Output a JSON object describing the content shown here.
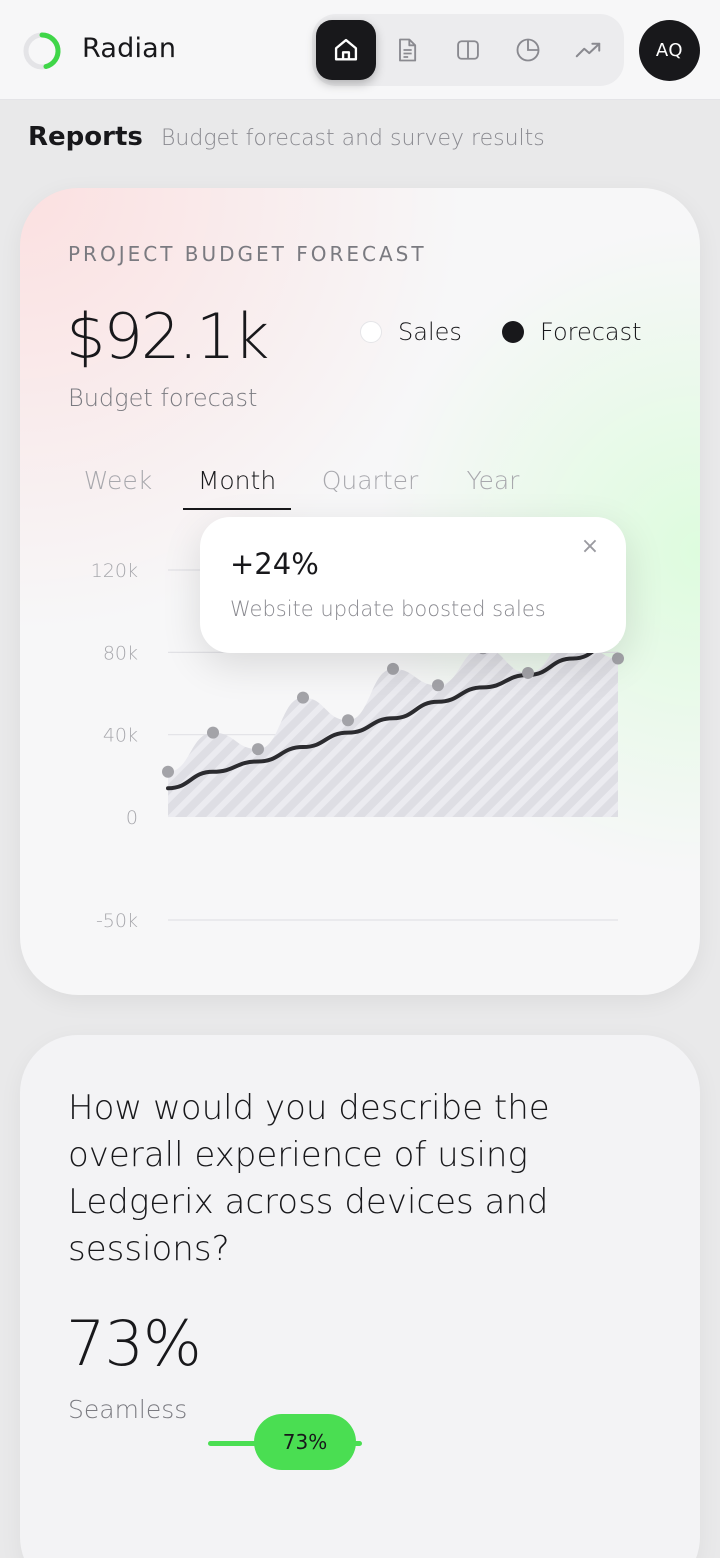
{
  "app": {
    "name": "Radian"
  },
  "nav": {
    "items": [
      {
        "icon": "home-icon",
        "active": true
      },
      {
        "icon": "document-icon",
        "active": false
      },
      {
        "icon": "split-view-icon",
        "active": false
      },
      {
        "icon": "pie-chart-icon",
        "active": false
      },
      {
        "icon": "trending-up-icon",
        "active": false
      }
    ]
  },
  "user": {
    "initials": "AQ"
  },
  "page": {
    "title": "Reports",
    "subtitle": "Budget forecast and survey results"
  },
  "forecast_card": {
    "label": "PROJECT BUDGET FORECAST",
    "value": "$92.1k",
    "value_label": "Budget forecast",
    "legend": {
      "sales": "Sales",
      "forecast": "Forecast"
    },
    "tabs": [
      "Week",
      "Month",
      "Quarter",
      "Year"
    ],
    "active_tab": "Month",
    "tooltip": {
      "value": "+24%",
      "text": "Website update boosted sales",
      "close": "×"
    }
  },
  "chart_data": {
    "type": "area",
    "ylim": [
      -50000,
      120000
    ],
    "y_ticks": [
      "120k",
      "80k",
      "40k",
      "0",
      "-50k"
    ],
    "y_tick_values": [
      120000,
      80000,
      40000,
      0,
      -50000
    ],
    "grid": true,
    "legend": "top-right",
    "series": [
      {
        "name": "Sales",
        "values": [
          22000,
          41000,
          33000,
          58000,
          47000,
          72000,
          64000,
          82000,
          70000,
          88000,
          77000
        ]
      },
      {
        "name": "Forecast",
        "values": [
          14000,
          22000,
          27000,
          34000,
          41000,
          48000,
          56000,
          63000,
          69000,
          77000,
          86000
        ]
      }
    ],
    "colors": {
      "sales_fill": "#dcdce3",
      "forecast_line": "#2b2b2f",
      "sales_dot": "#a3a3a8"
    }
  },
  "survey_card": {
    "question": "How would you describe the overall experience of using Ledgerix across devices and sessions?",
    "percent": "73%",
    "answer": "Seamless",
    "slider_label": "73%",
    "slider_value": 0.73,
    "accent": "#4ade52"
  }
}
